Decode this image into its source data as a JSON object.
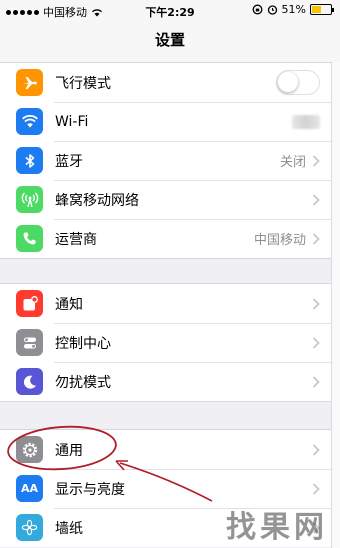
{
  "status_bar": {
    "carrier": "中国移动",
    "time": "下午2:29",
    "battery_percent": "51%",
    "battery_level": 0.51
  },
  "nav": {
    "title": "设置"
  },
  "groups": [
    {
      "rows": [
        {
          "label": "飞行模式",
          "icon": "airplane-icon",
          "icon_color": "#ff9500",
          "accessory": "toggle",
          "toggle_on": false
        },
        {
          "label": "Wi-Fi",
          "icon": "wifi-icon",
          "icon_color": "#1e7cf2",
          "accessory": "blurred-value"
        },
        {
          "label": "蓝牙",
          "icon": "bluetooth-icon",
          "icon_color": "#1e7cf2",
          "value": "关闭",
          "accessory": "chevron"
        },
        {
          "label": "蜂窝移动网络",
          "icon": "antenna-icon",
          "icon_color": "#4cd964",
          "accessory": "chevron"
        },
        {
          "label": "运营商",
          "icon": "phone-icon",
          "icon_color": "#4cd964",
          "value": "中国移动",
          "accessory": "chevron"
        }
      ]
    },
    {
      "rows": [
        {
          "label": "通知",
          "icon": "notifications-icon",
          "icon_color": "#ff3b30",
          "accessory": "chevron"
        },
        {
          "label": "控制中心",
          "icon": "control-center-icon",
          "icon_color": "#8e8e93",
          "accessory": "chevron"
        },
        {
          "label": "勿扰模式",
          "icon": "moon-icon",
          "icon_color": "#5856d6",
          "accessory": "chevron"
        }
      ]
    },
    {
      "rows": [
        {
          "label": "通用",
          "icon": "gear-icon",
          "icon_color": "#8e8e93",
          "accessory": "chevron"
        },
        {
          "label": "显示与亮度",
          "icon": "display-brightness-icon",
          "icon_color": "#1e7cf2",
          "icon_text": "AA",
          "accessory": "chevron"
        },
        {
          "label": "墙纸",
          "icon": "wallpaper-icon",
          "icon_color": "#34aadc",
          "accessory": "chevron"
        }
      ]
    }
  ],
  "colors": {
    "annotation": "#b01e2a",
    "chevron": "#c7c7cc"
  },
  "watermark": "找果网"
}
